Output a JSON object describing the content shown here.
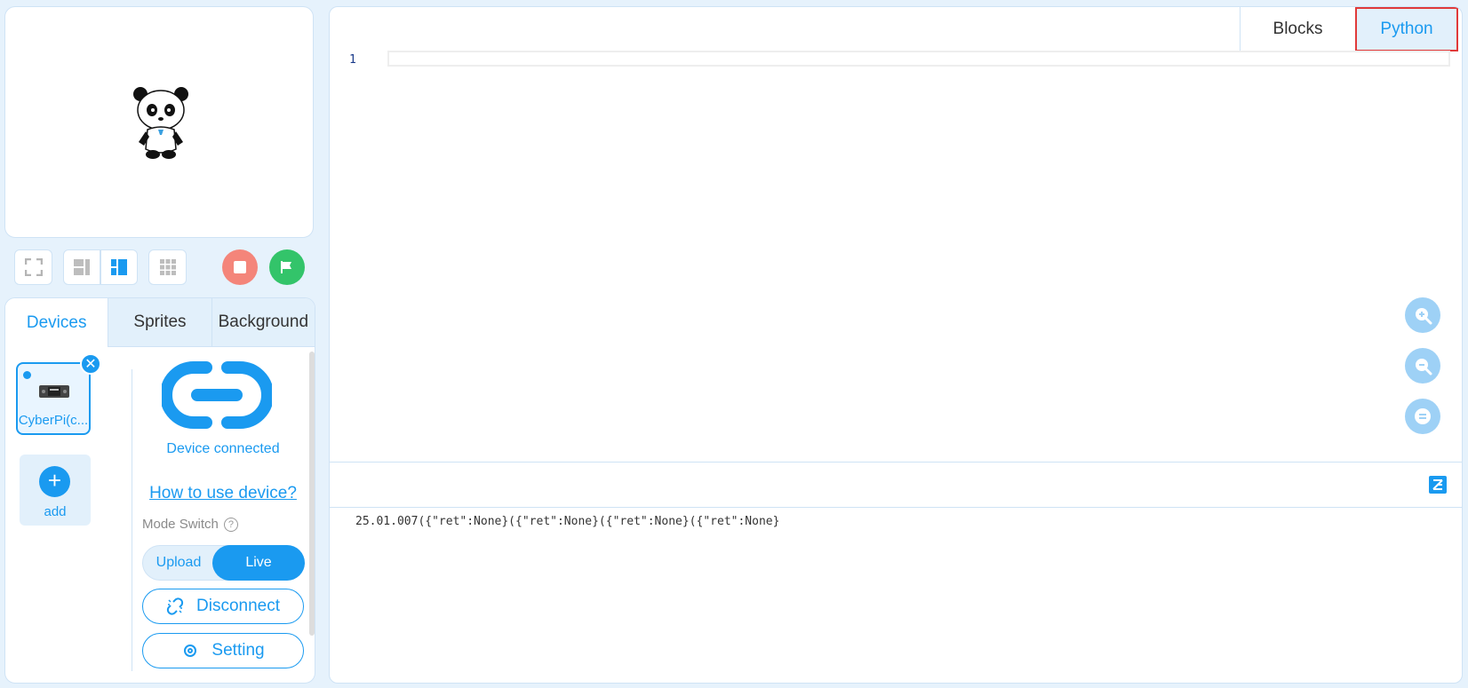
{
  "stage": {
    "sprite": "panda"
  },
  "toolbar": {
    "icons": [
      "fullscreen-icon",
      "small-stage-icon",
      "large-stage-icon",
      "grid-icon",
      "stop-icon",
      "green-flag-icon"
    ]
  },
  "panel": {
    "tabs": [
      {
        "label": "Devices",
        "active": true
      },
      {
        "label": "Sprites",
        "active": false
      },
      {
        "label": "Background",
        "active": false
      }
    ],
    "device": {
      "label": "CyberPi(c..."
    },
    "add_label": "add",
    "status": "Device connected",
    "how_to": "How to use device?",
    "mode_switch_label": "Mode Switch",
    "mode_help": "?",
    "mode_upload": "Upload",
    "mode_live": "Live",
    "disconnect": "Disconnect",
    "setting": "Setting"
  },
  "editor": {
    "tabs": {
      "blocks": "Blocks",
      "python": "Python"
    },
    "line_number": "1",
    "console_output": "25.01.007({\"ret\":None}({\"ret\":None}({\"ret\":None}({\"ret\":None}"
  },
  "colors": {
    "accent": "#1a9af0",
    "stop": "#f4857a",
    "go": "#33c46a",
    "highlight": "#e03a3a"
  }
}
